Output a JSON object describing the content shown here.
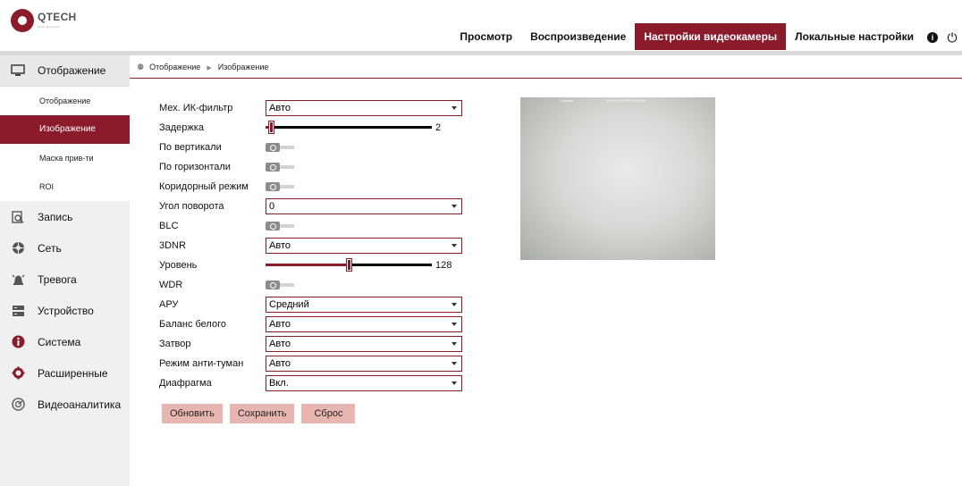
{
  "header": {
    "logo_text": "QTECH",
    "logo_sub": "ваш доступ",
    "nav": [
      {
        "label": "Просмотр"
      },
      {
        "label": "Воспроизведение"
      },
      {
        "label": "Настройки видеокамеры"
      },
      {
        "label": "Локальные настройки"
      }
    ],
    "info_glyph": "i",
    "power_glyph": "⏻"
  },
  "sidebar": {
    "groups": [
      {
        "label": "Отображение",
        "icon": "monitor-icon"
      },
      {
        "label": "Запись",
        "icon": "record-icon"
      },
      {
        "label": "Сеть",
        "icon": "network-icon"
      },
      {
        "label": "Тревога",
        "icon": "alarm-icon"
      },
      {
        "label": "Устройство",
        "icon": "device-icon"
      },
      {
        "label": "Система",
        "icon": "info-icon"
      },
      {
        "label": "Расширенные",
        "icon": "gear-icon"
      },
      {
        "label": "Видеоаналитика",
        "icon": "analytics-icon"
      }
    ],
    "subitems": [
      {
        "label": "Отображение"
      },
      {
        "label": "Изображение"
      },
      {
        "label": "Маска прив-ти"
      },
      {
        "label": "ROI"
      }
    ]
  },
  "breadcrumb": {
    "root": "Отображение",
    "current": "Изображение"
  },
  "form": {
    "ir_filter": {
      "label": "Мех. ИК-фильтр",
      "value": "Авто"
    },
    "delay": {
      "label": "Задержка",
      "value": "2",
      "fraction": 0.03
    },
    "vertical": {
      "label": "По вертикали"
    },
    "horizontal": {
      "label": "По горизонтали"
    },
    "corridor": {
      "label": "Коридорный режим"
    },
    "rotation": {
      "label": "Угол поворота",
      "value": "0"
    },
    "blc": {
      "label": "BLC"
    },
    "dnr": {
      "label": "3DNR",
      "value": "Авто"
    },
    "level": {
      "label": "Уровень",
      "value": "128",
      "fraction": 0.5
    },
    "wdr": {
      "label": "WDR"
    },
    "agc": {
      "label": "АРУ",
      "value": "Средний"
    },
    "white_balance": {
      "label": "Баланс белого",
      "value": "Авто"
    },
    "shutter": {
      "label": "Затвор",
      "value": "Авто"
    },
    "antifog": {
      "label": "Режим анти-туман",
      "value": "Авто"
    },
    "iris": {
      "label": "Диафрагма",
      "value": "Вкл."
    }
  },
  "buttons": {
    "refresh": "Обновить",
    "save": "Сохранить",
    "reset": "Сброс"
  },
  "preview": {
    "osd_name": "Camera",
    "osd_time": "2019-12-09 07:52:15 AM"
  },
  "colors": {
    "accent": "#8b1b2b",
    "button_bg": "#e7b6b0",
    "sidebar_bg": "#f0f0f0"
  }
}
